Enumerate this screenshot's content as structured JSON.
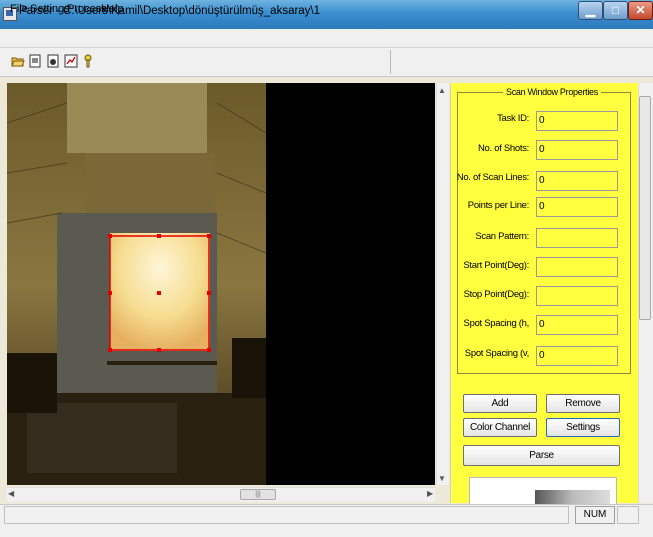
{
  "window": {
    "title": "Parser - C:\\Users\\Kamil\\Desktop\\dönüştürülmüş_aksaray\\1",
    "minimize_glyph": "▁",
    "maximize_glyph": "□",
    "close_glyph": "✕"
  },
  "menu": [
    "File",
    "Settings",
    "Process",
    "Help"
  ],
  "toolbar_icons": [
    "open-folder-icon",
    "open-file-icon",
    "camera-icon",
    "image-scan-icon",
    "help-icon"
  ],
  "properties": {
    "title": "Scan Window Properties",
    "fields": [
      {
        "label": "Task ID:",
        "value": "0"
      },
      {
        "label": "No. of Shots:",
        "value": "0"
      },
      {
        "label": "No. of Scan Lines:",
        "value": "0"
      },
      {
        "label": "Points per Line:",
        "value": "0"
      },
      {
        "label": "Scan Pattern:",
        "value": ""
      },
      {
        "label": "Start Point(Deg):",
        "value": ""
      },
      {
        "label": "Stop Point(Deg):",
        "value": ""
      },
      {
        "label": "Spot Spacing (h,",
        "value": "0"
      },
      {
        "label": "Spot Spacing (v,",
        "value": "0"
      }
    ]
  },
  "buttons": {
    "add": "Add",
    "remove": "Remove",
    "color_channel": "Color Channel",
    "settings": "Settings",
    "parse": "Parse"
  },
  "scrollbar_grip": "|||",
  "status": {
    "num": "NUM"
  },
  "colors": {
    "panel_bg": "#ffff40",
    "scan_rect": "#e00000"
  }
}
